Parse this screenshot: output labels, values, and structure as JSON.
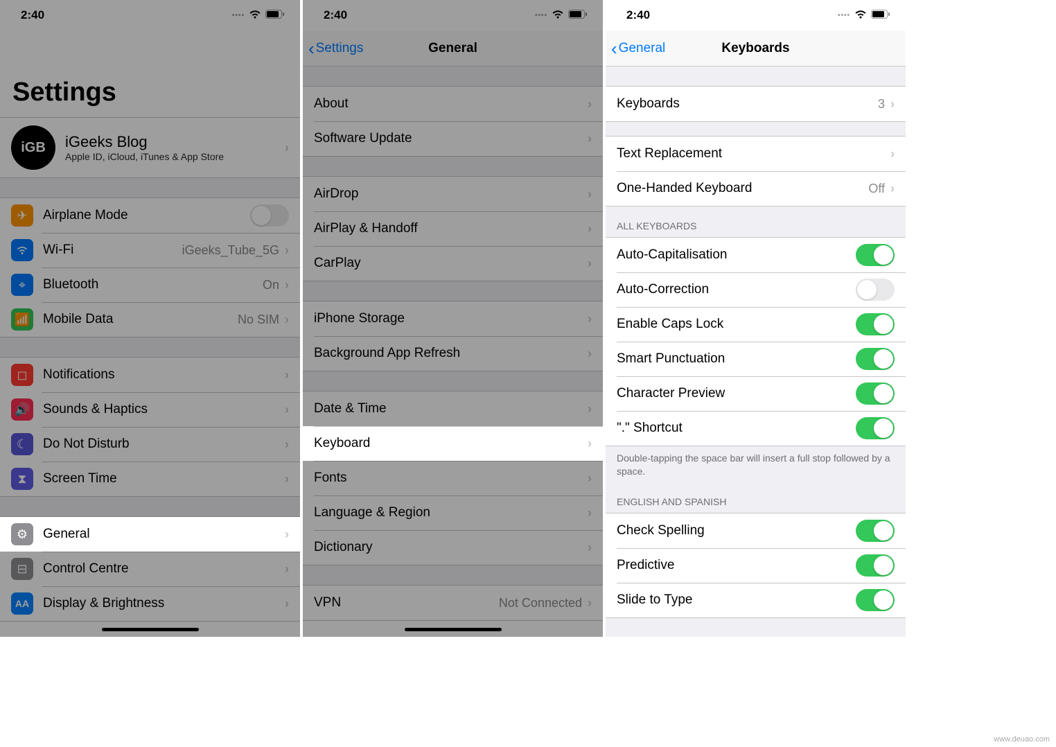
{
  "status": {
    "time": "2:40"
  },
  "watermark": "www.deuao.com",
  "screen1": {
    "title": "Settings",
    "profile": {
      "avatar_text": "iGB",
      "name": "iGeeks Blog",
      "subtitle": "Apple ID, iCloud, iTunes & App Store"
    },
    "rows": {
      "airplane": "Airplane Mode",
      "wifi": "Wi-Fi",
      "wifi_value": "iGeeks_Tube_5G",
      "bluetooth": "Bluetooth",
      "bluetooth_value": "On",
      "mobile": "Mobile Data",
      "mobile_value": "No SIM",
      "notifications": "Notifications",
      "sounds": "Sounds & Haptics",
      "dnd": "Do Not Disturb",
      "screentime": "Screen Time",
      "general": "General",
      "control": "Control Centre",
      "display": "Display & Brightness"
    }
  },
  "screen2": {
    "back": "Settings",
    "title": "General",
    "rows": {
      "about": "About",
      "software": "Software Update",
      "airdrop": "AirDrop",
      "airplay": "AirPlay & Handoff",
      "carplay": "CarPlay",
      "storage": "iPhone Storage",
      "refresh": "Background App Refresh",
      "datetime": "Date & Time",
      "keyboard": "Keyboard",
      "fonts": "Fonts",
      "language": "Language & Region",
      "dictionary": "Dictionary",
      "vpn": "VPN",
      "vpn_value": "Not Connected"
    }
  },
  "screen3": {
    "back": "General",
    "title": "Keyboards",
    "rows": {
      "keyboards": "Keyboards",
      "keyboards_value": "3",
      "text_replacement": "Text Replacement",
      "one_handed": "One-Handed Keyboard",
      "one_handed_value": "Off"
    },
    "section_all": "ALL KEYBOARDS",
    "toggles": {
      "autocap": "Auto-Capitalisation",
      "autocorrect": "Auto-Correction",
      "capslock": "Enable Caps Lock",
      "smart": "Smart Punctuation",
      "preview": "Character Preview",
      "dot": "\".\" Shortcut"
    },
    "toggle_states": {
      "autocap": true,
      "autocorrect": false,
      "capslock": true,
      "smart": true,
      "preview": true,
      "dot": true,
      "spelling": true,
      "predictive": true,
      "slide": true
    },
    "footer": "Double-tapping the space bar will insert a full stop followed by a space.",
    "section_lang": "ENGLISH AND SPANISH",
    "lang_toggles": {
      "spelling": "Check Spelling",
      "predictive": "Predictive",
      "slide": "Slide to Type"
    }
  }
}
